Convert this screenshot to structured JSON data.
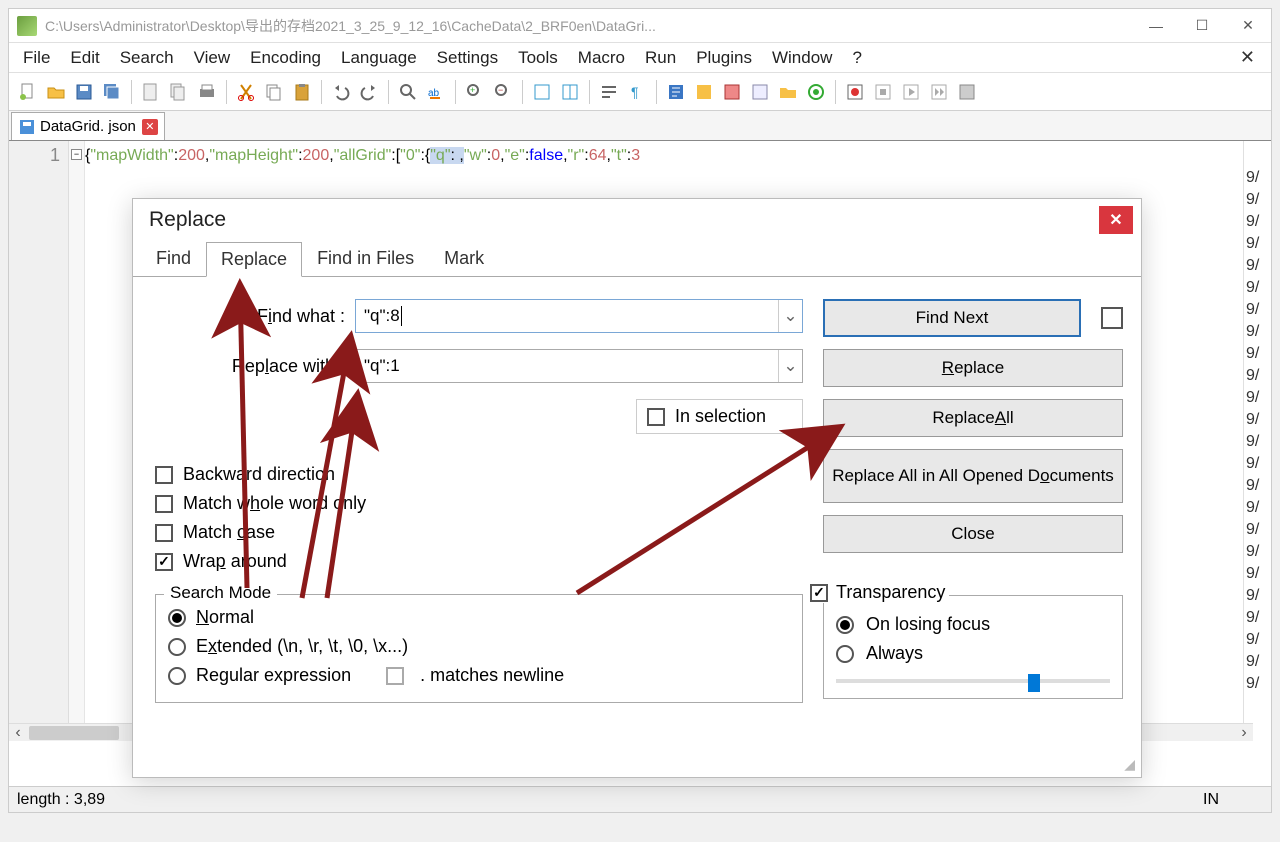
{
  "titlebar": {
    "path": "C:\\Users\\Administrator\\Desktop\\导出的存档2021_3_25_9_12_16\\CacheData\\2_BRF0en\\DataGri..."
  },
  "menu": [
    "File",
    "Edit",
    "Search",
    "View",
    "Encoding",
    "Language",
    "Settings",
    "Tools",
    "Macro",
    "Run",
    "Plugins",
    "Window",
    "?"
  ],
  "file_tab": {
    "name": "DataGrid. json"
  },
  "editor": {
    "line_number": "1",
    "code_prefix_punct": "{",
    "code_kv1_key": "\"mapWidth\"",
    "code_kv1_val": "200",
    "code_kv2_key": "\"mapHeight\"",
    "code_kv2_val": "200",
    "code_kv3_key": "\"allGrid\"",
    "code_arr_start": ":[",
    "code_idx": "\"0\"",
    "code_inner_open": ":{",
    "code_q_key": "\"q\"",
    "code_w_key": "\"w\"",
    "code_w_val": "0",
    "code_e_key": "\"e\"",
    "code_e_val": "false",
    "code_r_key": "\"r\"",
    "code_r_val": "64",
    "code_t_key": "\"t\"",
    "code_t_val": "3",
    "right_col_vals": [
      "",
      "9/",
      "9/",
      "9/",
      "9/",
      "9/",
      "9/",
      "9/",
      "9/",
      "9/",
      "9/",
      "9/",
      "9/",
      "9/",
      "9/",
      "9/",
      "9/",
      "9/",
      "9/",
      "9/",
      "9/",
      "9/",
      "9/",
      "9/",
      "9/"
    ]
  },
  "dialog": {
    "title": "Replace",
    "tabs": [
      "Find",
      "Replace",
      "Find in Files",
      "Mark"
    ],
    "active_tab": 1,
    "find_label_pre": "F",
    "find_label_u": "i",
    "find_label_post": "nd what :",
    "replace_label_pre": "Rep",
    "replace_label_u": "l",
    "replace_label_post": "ace with :",
    "find_value": "\"q\":8",
    "replace_value": "\"q\":1",
    "in_selection": "In selection",
    "options": {
      "backward": "Backward direction",
      "whole_pre": "Match w",
      "whole_u": "h",
      "whole_post": "ole word only",
      "case_pre": "Match ",
      "case_u": "c",
      "case_post": "ase",
      "wrap_pre": "Wra",
      "wrap_u": "p",
      "wrap_post": " around",
      "wrap_checked": true
    },
    "search_mode": {
      "legend": "Search Mode",
      "normal_u": "N",
      "normal_post": "ormal",
      "extended_pre": "E",
      "extended_u": "x",
      "extended_post": "tended (\\n, \\r, \\t, \\0, \\x...)",
      "regex_pre": "Re",
      "regex_u": "g",
      "regex_post": "ular expression",
      "matches_newline": ". matches newline",
      "selected": "normal"
    },
    "buttons": {
      "find_next": "Find Next",
      "replace_u": "R",
      "replace_post": "eplace",
      "replace_all_pre": "Replace ",
      "replace_all_u": "A",
      "replace_all_post": "ll",
      "replace_all_docs_pre": "Replace All in All Opened D",
      "replace_all_docs_u": "o",
      "replace_all_docs_post": "cuments",
      "close": "Close"
    },
    "transparency": {
      "label": "Transparency",
      "on_losing": "On losing focus",
      "always": "Always",
      "checked": true,
      "selected": "on_losing"
    }
  },
  "statusbar": {
    "length": "length : 3,89",
    "ins": "IN"
  }
}
